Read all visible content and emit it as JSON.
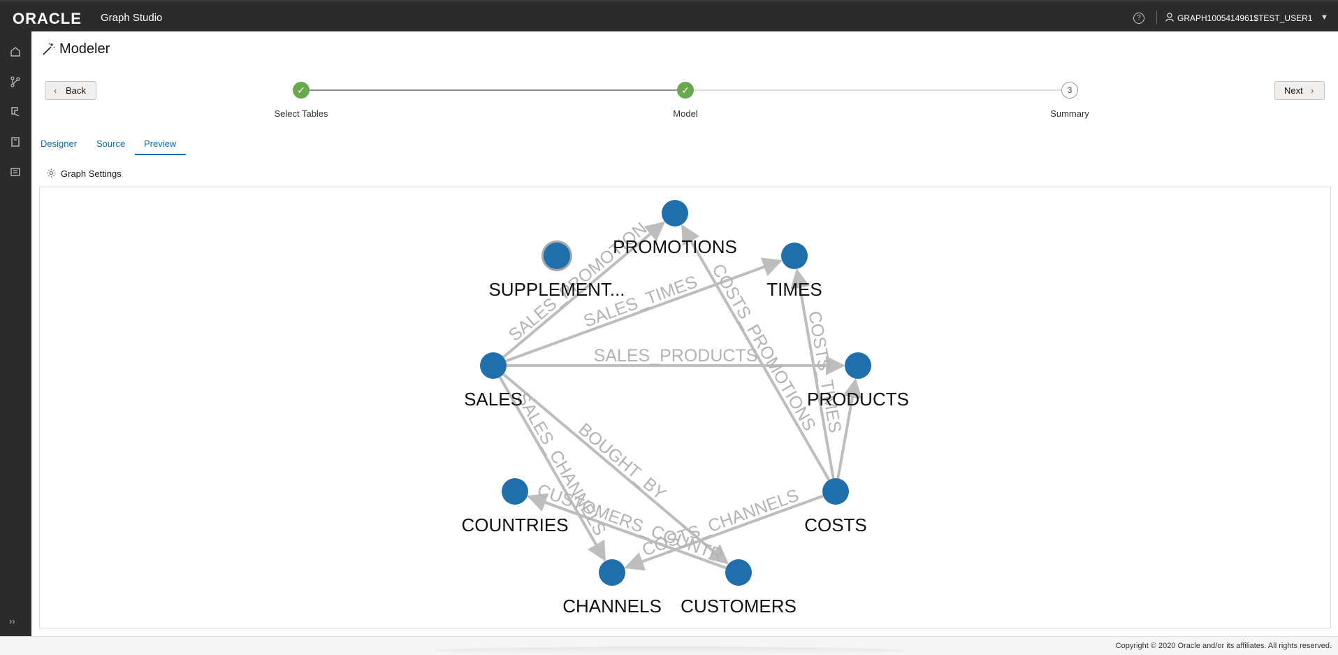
{
  "app": {
    "brand": "ORACLE",
    "product": "Graph Studio"
  },
  "user": {
    "name": "GRAPH1005414961$TEST_USER1"
  },
  "page": {
    "title": "Modeler"
  },
  "buttons": {
    "back": "Back",
    "next": "Next"
  },
  "stepper": {
    "steps": [
      {
        "label": "Select Tables",
        "state": "done"
      },
      {
        "label": "Model",
        "state": "done"
      },
      {
        "label": "Summary",
        "state": "pending",
        "number": "3"
      }
    ]
  },
  "tabs": [
    {
      "label": "Designer"
    },
    {
      "label": "Source"
    },
    {
      "label": "Preview",
      "active": true
    }
  ],
  "graph_settings": {
    "label": "Graph Settings"
  },
  "graph": {
    "nodes": [
      {
        "id": "PROMOTIONS",
        "label": "PROMOTIONS"
      },
      {
        "id": "SUPPLEMENT",
        "label": "SUPPLEMENT...",
        "selected": true
      },
      {
        "id": "TIMES",
        "label": "TIMES"
      },
      {
        "id": "SALES",
        "label": "SALES"
      },
      {
        "id": "PRODUCTS",
        "label": "PRODUCTS"
      },
      {
        "id": "COUNTRIES",
        "label": "COUNTRIES"
      },
      {
        "id": "COSTS",
        "label": "COSTS"
      },
      {
        "id": "CHANNELS",
        "label": "CHANNELS"
      },
      {
        "id": "CUSTOMERS",
        "label": "CUSTOMERS"
      }
    ],
    "edges": [
      {
        "from": "SALES",
        "to": "PROMOTIONS",
        "label": "SALES_PROMOTION"
      },
      {
        "from": "SALES",
        "to": "TIMES",
        "label": "SALES_TIMES"
      },
      {
        "from": "SALES",
        "to": "PRODUCTS",
        "label": "SALES_PRODUCTS"
      },
      {
        "from": "SALES",
        "to": "CHANNELS",
        "label": "SALES_CHANNELS"
      },
      {
        "from": "SALES",
        "to": "CUSTOMERS",
        "label": "BOUGHT_BY"
      },
      {
        "from": "CUSTOMERS",
        "to": "COUNTRIES",
        "label": "CUSTOMERS_COUNTR"
      },
      {
        "from": "COSTS",
        "to": "PROMOTIONS",
        "label": "COSTS_PROMOTIONS"
      },
      {
        "from": "COSTS",
        "to": "TIMES",
        "label": "COSTS_TIMES"
      },
      {
        "from": "COSTS",
        "to": "PRODUCTS",
        "label": ""
      },
      {
        "from": "COSTS",
        "to": "CHANNELS",
        "label": "COSTS_CHANNELS"
      }
    ],
    "colors": {
      "node": "#1f6fad",
      "edge": "#bdbdbd",
      "selected_ring": "#a7a7a7"
    }
  },
  "footer": {
    "copyright": "Copyright © 2020 Oracle and/or its affiliates. All rights reserved."
  },
  "colors": {
    "topbar": "#2b2b2b",
    "accent": "#0b6db3",
    "step_done": "#6aa84f"
  }
}
